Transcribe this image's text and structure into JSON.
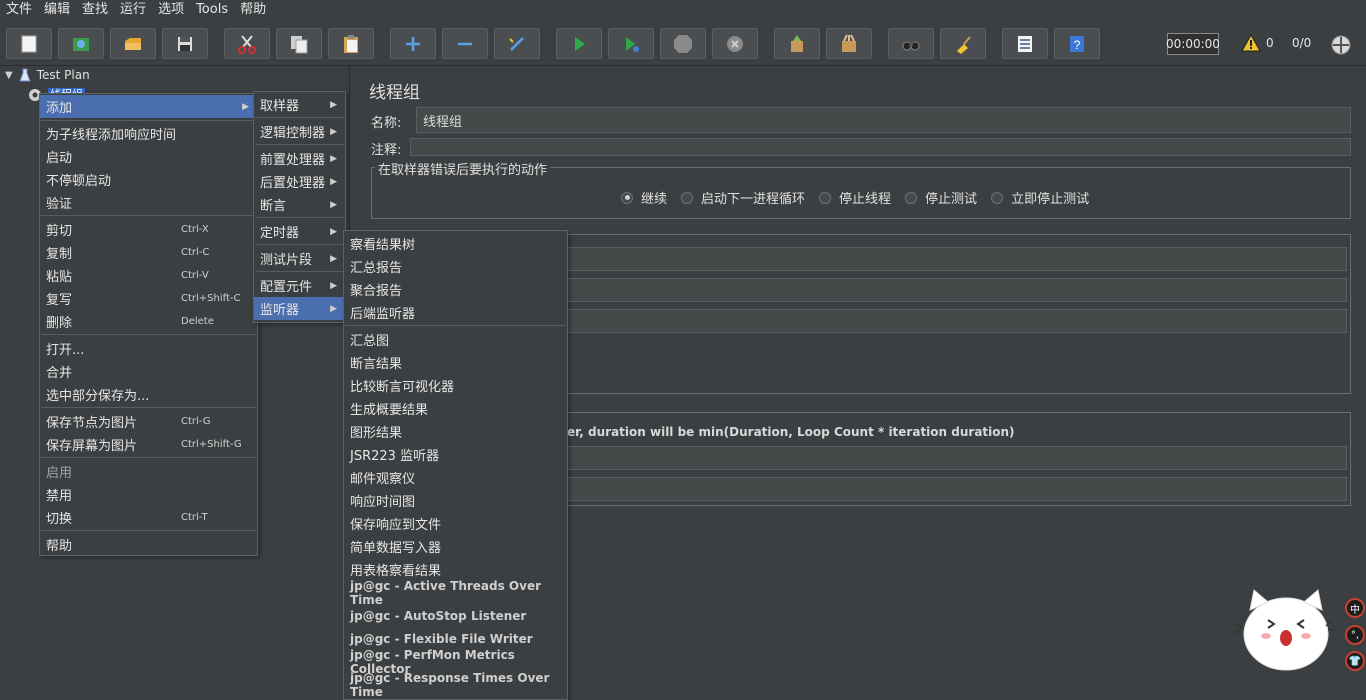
{
  "menubar": {
    "items": [
      "文件",
      "编辑",
      "查找",
      "运行",
      "选项",
      "Tools",
      "帮助"
    ]
  },
  "toolbar": {
    "buttons": [
      "new-icon",
      "templates-icon",
      "open-icon",
      "save-icon",
      "cut-icon",
      "copy-icon",
      "paste-icon",
      "expand-icon",
      "collapse-icon",
      "toggle-icon",
      "start-icon",
      "start-no-pause-icon",
      "stop-icon",
      "shutdown-icon",
      "clear-icon",
      "clear-all-icon",
      "search-icon",
      "reset-search-icon",
      "function-helper-icon",
      "help-icon"
    ],
    "timer": "00:00:00",
    "warning_count": "0",
    "threads": "0/0"
  },
  "tree": {
    "root": "Test Plan",
    "child": "线程组"
  },
  "panel": {
    "title": "线程组",
    "name_label": "名称:",
    "name_value": "线程组",
    "comment_label": "注释:",
    "comment_value": "",
    "error_group_title": "在取样器错误后要执行的动作",
    "radios": [
      {
        "label": "继续",
        "checked": true
      },
      {
        "label": "启动下一进程循环",
        "checked": false
      },
      {
        "label": "停止线程",
        "checked": false
      },
      {
        "label": "停止测试",
        "checked": false
      },
      {
        "label": "立即停止测试",
        "checked": false
      }
    ],
    "duration_hint": "er, duration will be min(Duration, Loop Count * iteration duration)"
  },
  "context_menu": {
    "items": [
      {
        "label": "添加",
        "shortcut": "",
        "submenu": true
      },
      {
        "label": "为子线程添加响应时间",
        "shortcut": ""
      },
      {
        "label": "启动",
        "shortcut": ""
      },
      {
        "label": "不停顿启动",
        "shortcut": ""
      },
      {
        "label": "验证",
        "shortcut": ""
      },
      {
        "label": "剪切",
        "shortcut": "Ctrl-X"
      },
      {
        "label": "复制",
        "shortcut": "Ctrl-C"
      },
      {
        "label": "粘贴",
        "shortcut": "Ctrl-V"
      },
      {
        "label": "复写",
        "shortcut": "Ctrl+Shift-C"
      },
      {
        "label": "删除",
        "shortcut": "Delete"
      },
      {
        "label": "打开...",
        "shortcut": ""
      },
      {
        "label": "合并",
        "shortcut": ""
      },
      {
        "label": "选中部分保存为...",
        "shortcut": ""
      },
      {
        "label": "保存节点为图片",
        "shortcut": "Ctrl-G"
      },
      {
        "label": "保存屏幕为图片",
        "shortcut": "Ctrl+Shift-G"
      },
      {
        "label": "启用",
        "shortcut": ""
      },
      {
        "label": "禁用",
        "shortcut": ""
      },
      {
        "label": "切换",
        "shortcut": "Ctrl-T"
      },
      {
        "label": "帮助",
        "shortcut": ""
      }
    ]
  },
  "add_submenu": {
    "items": [
      "取样器",
      "逻辑控制器",
      "前置处理器",
      "后置处理器",
      "断言",
      "定时器",
      "测试片段",
      "配置元件",
      "监听器"
    ]
  },
  "listener_submenu": {
    "items": [
      "察看结果树",
      "汇总报告",
      "聚合报告",
      "后端监听器",
      "汇总图",
      "断言结果",
      "比较断言可视化器",
      "生成概要结果",
      "图形结果",
      "JSR223 监听器",
      "邮件观察仪",
      "响应时间图",
      "保存响应到文件",
      "简单数据写入器",
      "用表格察看结果",
      "jp@gc - Active Threads Over Time",
      "jp@gc - AutoStop Listener",
      "jp@gc - Flexible File Writer",
      "jp@gc - PerfMon Metrics Collector",
      "jp@gc - Response Times Over Time"
    ]
  },
  "side_buttons": [
    "中",
    "°,",
    "👕"
  ]
}
